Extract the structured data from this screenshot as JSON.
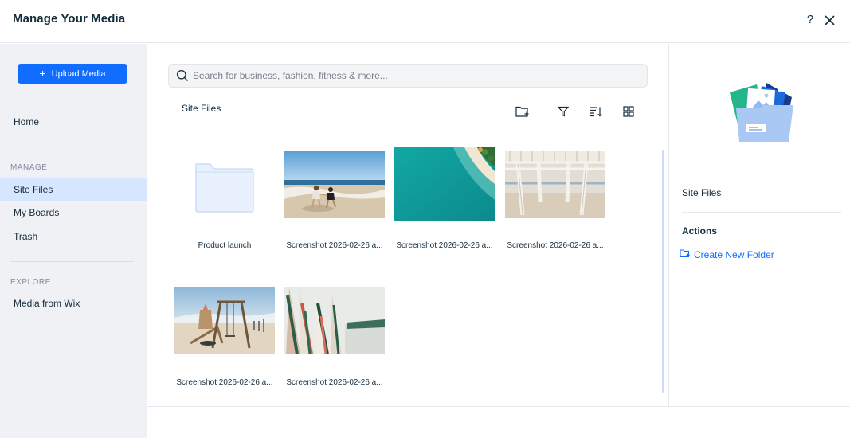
{
  "header": {
    "title": "Manage Your Media",
    "help_label": "?",
    "close_icon": "close-icon"
  },
  "sidebar": {
    "upload_label": "Upload Media",
    "home_label": "Home",
    "manage_section": "MANAGE",
    "items": [
      {
        "label": "Site Files",
        "active": true
      },
      {
        "label": "My Boards",
        "active": false
      },
      {
        "label": "Trash",
        "active": false
      }
    ],
    "explore_section": "EXPLORE",
    "explore_items": [
      {
        "label": "Media from Wix"
      }
    ]
  },
  "main": {
    "search_placeholder": "Search for business, fashion, fitness & more...",
    "breadcrumb": "Site Files",
    "toolbar": [
      "new-folder-icon",
      "filter-icon",
      "sort-icon",
      "grid-view-icon"
    ],
    "items": [
      {
        "type": "folder",
        "label": "Product launch"
      },
      {
        "type": "image",
        "label": "Screenshot 2026-02-26 a...",
        "scene": "beach-children"
      },
      {
        "type": "image",
        "label": "Screenshot 2026-02-26 a...",
        "scene": "aerial-beach"
      },
      {
        "type": "image",
        "label": "Screenshot 2026-02-26 a...",
        "scene": "beach-pergola"
      },
      {
        "type": "image",
        "label": "Screenshot 2026-02-26 a...",
        "scene": "beach-playground"
      },
      {
        "type": "image",
        "label": "Screenshot 2026-02-26 a...",
        "scene": "beach-umbrellas"
      }
    ]
  },
  "panel": {
    "selected_name": "Site Files",
    "actions_title": "Actions",
    "create_folder_label": "Create New Folder"
  },
  "colors": {
    "accent": "#116dff",
    "sidebar_bg": "#eff1f5",
    "active_item_bg": "#d6e6fe",
    "text": "#162d3d"
  }
}
